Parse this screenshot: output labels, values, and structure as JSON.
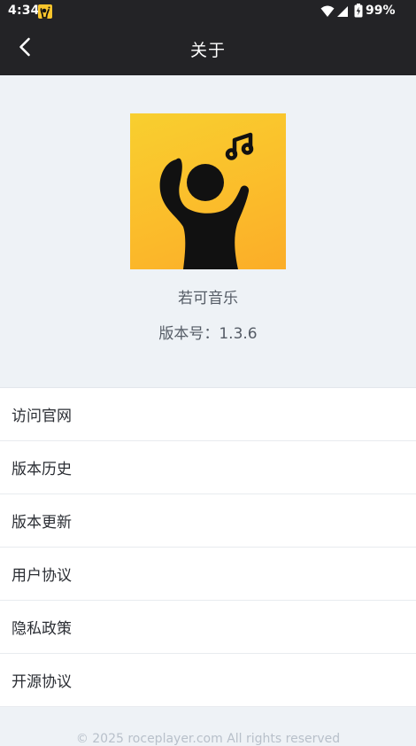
{
  "status_bar": {
    "time": "4:34",
    "battery": "99%"
  },
  "header": {
    "title": "关于"
  },
  "app": {
    "name": "若可音乐",
    "version": "版本号：1.3.6"
  },
  "menu": {
    "items": [
      {
        "label": "访问官网"
      },
      {
        "label": "版本历史"
      },
      {
        "label": "版本更新"
      },
      {
        "label": "用户协议"
      },
      {
        "label": "隐私政策"
      },
      {
        "label": "开源协议"
      }
    ]
  },
  "footer": {
    "copyright": "© 2025 roceplayer.com All rights reserved"
  },
  "colors": {
    "bar_background": "#232326",
    "page_background": "#eef2f6",
    "logo_yellow": "#f9c52c"
  }
}
